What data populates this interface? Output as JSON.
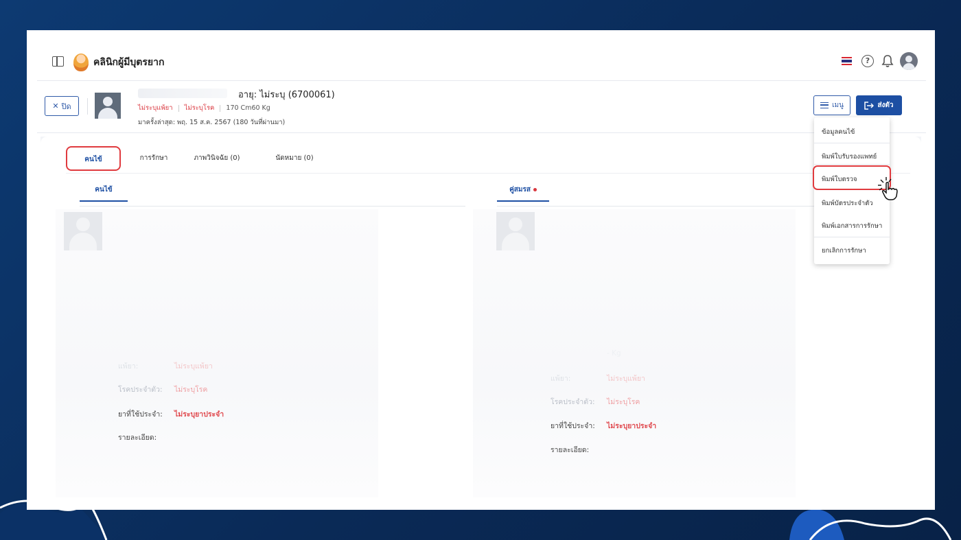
{
  "app": {
    "brand_name": "คลินิกผู้มีบุตรยาก",
    "icons": [
      "sidebar-toggle-icon",
      "clinic-logo-icon",
      "thai-flag-icon",
      "help-icon",
      "bell-icon",
      "user-avatar-icon"
    ]
  },
  "patient": {
    "close_label": "ปิด",
    "age_line": "อายุ: ไม่ระบุ  (6700061)",
    "allergy_tag": "ไม่ระบุแพ้ยา",
    "disease_tag": "ไม่ระบุโรค",
    "body_stats": "170 Cm60 Kg",
    "last_visit": "มาครั้งล่าสุด: พฤ. 15 ส.ค. 2567 (180 วันที่ผ่านมา)",
    "menu_label": "เมนู",
    "send_label": "ส่งตัว"
  },
  "tabs": {
    "patient": "คนไข้",
    "treatment": "การรักษา",
    "imaging": "ภาพวินิจฉัย (0)",
    "appointment": "นัดหมาย (0)"
  },
  "subtabs": {
    "left": "คนไข้",
    "right": "คู่สมรส"
  },
  "left_panel": {
    "allergy_label": "แพ้ยา:",
    "allergy_value": "ไม่ระบุแพ้ยา",
    "disease_label": "โรคประจำตัว:",
    "disease_value": "ไม่ระบุโรค",
    "medicine_label": "ยาที่ใช้ประจำ:",
    "medicine_value": "ไม่ระบุยาประจำ",
    "detail_label": "รายละเอียด:"
  },
  "right_panel": {
    "weight_value": "- Kg",
    "allergy_label": "แพ้ยา:",
    "allergy_value": "ไม่ระบุแพ้ยา",
    "disease_label": "โรคประจำตัว:",
    "disease_value": "ไม่ระบุโรค",
    "medicine_label": "ยาที่ใช้ประจำ:",
    "medicine_value": "ไม่ระบุยาประจำ",
    "detail_label": "รายละเอียด:"
  },
  "dropdown": {
    "items": [
      "ข้อมูลคนไข้",
      "พิมพ์ใบรับรองแพทย์",
      "พิมพ์ใบตรวจ",
      "พิมพ์บัตรประจำตัว",
      "พิมพ์เอกสารการรักษา",
      "ยกเลิกการรักษา"
    ]
  },
  "colors": {
    "accent": "#1d4fa3",
    "highlight": "#e03a3e",
    "warning_text": "#d9363e",
    "background": "#0a2a57"
  }
}
